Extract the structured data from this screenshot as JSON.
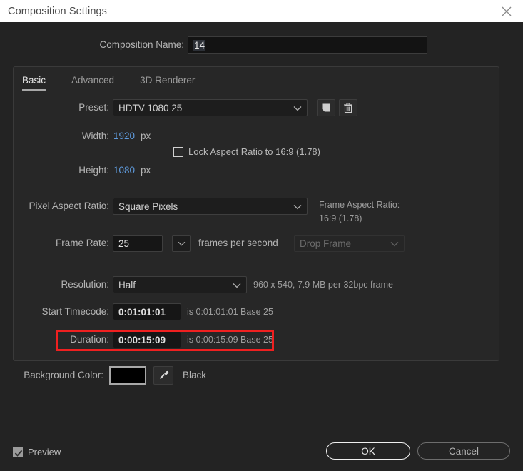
{
  "window": {
    "title": "Composition Settings",
    "close_icon": "close-icon"
  },
  "composition_name": {
    "label": "Composition Name:",
    "value": "14"
  },
  "tabs": [
    {
      "label": "Basic",
      "active": true
    },
    {
      "label": "Advanced",
      "active": false
    },
    {
      "label": "3D Renderer",
      "active": false
    }
  ],
  "preset": {
    "label": "Preset:",
    "value": "HDTV 1080 25",
    "save_icon": "save-preset-icon",
    "delete_icon": "trash-icon"
  },
  "width": {
    "label": "Width:",
    "value": "1920",
    "unit": "px"
  },
  "height": {
    "label": "Height:",
    "value": "1080",
    "unit": "px"
  },
  "lock_aspect": {
    "label": "Lock Aspect Ratio to 16:9 (1.78)",
    "checked": false
  },
  "pixel_aspect_ratio": {
    "label": "Pixel Aspect Ratio:",
    "value": "Square Pixels"
  },
  "frame_aspect_ratio": {
    "label": "Frame Aspect Ratio:",
    "value": "16:9 (1.78)"
  },
  "frame_rate": {
    "label": "Frame Rate:",
    "value": "25",
    "unit": "frames per second",
    "drop_frame": "Drop Frame"
  },
  "resolution": {
    "label": "Resolution:",
    "value": "Half",
    "info": "960 x 540, 7.9 MB per 32bpc frame"
  },
  "start_timecode": {
    "label": "Start Timecode:",
    "value": "0:01:01:01",
    "info": "is 0:01:01:01  Base 25"
  },
  "duration": {
    "label": "Duration:",
    "value": "0:00:15:09",
    "info": "is 0:00:15:09  Base 25",
    "highlight_color": "#ef2020"
  },
  "background_color": {
    "label": "Background Color:",
    "swatch": "#000000",
    "eyedropper_icon": "eyedropper-icon",
    "name": "Black"
  },
  "footer": {
    "preview": {
      "label": "Preview",
      "checked": true
    },
    "ok_label": "OK",
    "cancel_label": "Cancel"
  }
}
